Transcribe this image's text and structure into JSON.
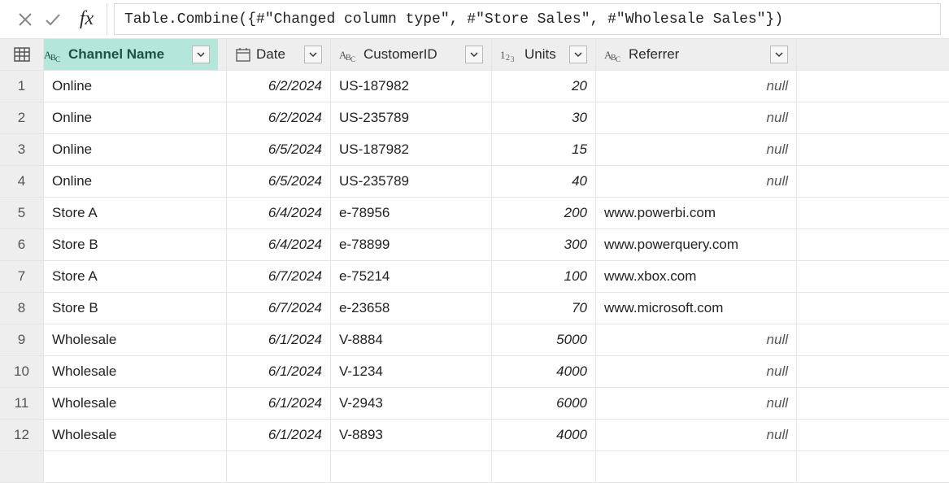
{
  "formula_bar": {
    "fx_label": "fx",
    "formula": "Table.Combine({#\"Changed column type\", #\"Store Sales\", #\"Wholesale Sales\"})"
  },
  "columns": {
    "channel": {
      "label": "Channel Name",
      "type": "text"
    },
    "date": {
      "label": "Date",
      "type": "date"
    },
    "cust": {
      "label": "CustomerID",
      "type": "text"
    },
    "units": {
      "label": "Units",
      "type": "number"
    },
    "ref": {
      "label": "Referrer",
      "type": "text"
    }
  },
  "rows": [
    {
      "n": "1",
      "channel": "Online",
      "date": "6/2/2024",
      "cust": "US-187982",
      "units": "20",
      "ref": null
    },
    {
      "n": "2",
      "channel": "Online",
      "date": "6/2/2024",
      "cust": "US-235789",
      "units": "30",
      "ref": null
    },
    {
      "n": "3",
      "channel": "Online",
      "date": "6/5/2024",
      "cust": "US-187982",
      "units": "15",
      "ref": null
    },
    {
      "n": "4",
      "channel": "Online",
      "date": "6/5/2024",
      "cust": "US-235789",
      "units": "40",
      "ref": null
    },
    {
      "n": "5",
      "channel": "Store A",
      "date": "6/4/2024",
      "cust": "e-78956",
      "units": "200",
      "ref": "www.powerbi.com"
    },
    {
      "n": "6",
      "channel": "Store B",
      "date": "6/4/2024",
      "cust": "e-78899",
      "units": "300",
      "ref": "www.powerquery.com"
    },
    {
      "n": "7",
      "channel": "Store A",
      "date": "6/7/2024",
      "cust": "e-75214",
      "units": "100",
      "ref": "www.xbox.com"
    },
    {
      "n": "8",
      "channel": "Store B",
      "date": "6/7/2024",
      "cust": "e-23658",
      "units": "70",
      "ref": "www.microsoft.com"
    },
    {
      "n": "9",
      "channel": "Wholesale",
      "date": "6/1/2024",
      "cust": "V-8884",
      "units": "5000",
      "ref": null
    },
    {
      "n": "10",
      "channel": "Wholesale",
      "date": "6/1/2024",
      "cust": "V-1234",
      "units": "4000",
      "ref": null
    },
    {
      "n": "11",
      "channel": "Wholesale",
      "date": "6/1/2024",
      "cust": "V-2943",
      "units": "6000",
      "ref": null
    },
    {
      "n": "12",
      "channel": "Wholesale",
      "date": "6/1/2024",
      "cust": "V-8893",
      "units": "4000",
      "ref": null
    }
  ],
  "null_label": "null"
}
